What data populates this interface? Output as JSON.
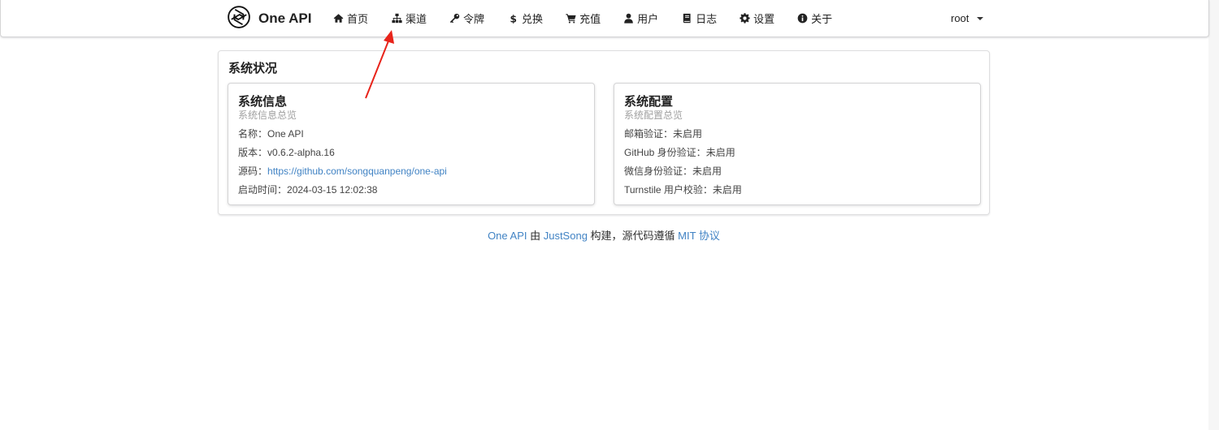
{
  "app": {
    "name": "One API",
    "brand_icon": "openai-logo-icon"
  },
  "nav": {
    "items": [
      {
        "label": "首页",
        "icon": "home-icon"
      },
      {
        "label": "渠道",
        "icon": "sitemap-icon"
      },
      {
        "label": "令牌",
        "icon": "key-icon"
      },
      {
        "label": "兑换",
        "icon": "dollar-icon"
      },
      {
        "label": "充值",
        "icon": "cart-icon"
      },
      {
        "label": "用户",
        "icon": "user-icon"
      },
      {
        "label": "日志",
        "icon": "book-icon"
      },
      {
        "label": "设置",
        "icon": "gear-icon"
      },
      {
        "label": "关于",
        "icon": "info-icon"
      }
    ],
    "user": "root"
  },
  "status": {
    "title": "系统状况",
    "info": {
      "header": "系统信息",
      "meta": "系统信息总览",
      "name_label": "名称：",
      "name_value": "One API",
      "version_label": "版本：",
      "version_value": "v0.6.2-alpha.16",
      "source_label": "源码：",
      "source_value": "https://github.com/songquanpeng/one-api",
      "start_label": "启动时间：",
      "start_value": "2024-03-15 12:02:38"
    },
    "config": {
      "header": "系统配置",
      "meta": "系统配置总览",
      "email_label": "邮箱验证：",
      "email_value": "未启用",
      "github_label": "GitHub 身份验证：",
      "github_value": "未启用",
      "wechat_label": "微信身份验证：",
      "wechat_value": "未启用",
      "turnstile_label": "Turnstile 用户校验：",
      "turnstile_value": "未启用"
    }
  },
  "footer": {
    "project": "One API",
    "by": " 由 ",
    "author": "JustSong",
    "middle": " 构建，源代码遵循 ",
    "license": "MIT 协议"
  },
  "colors": {
    "link": "#4183c4",
    "annotation_arrow": "#e8231a"
  }
}
